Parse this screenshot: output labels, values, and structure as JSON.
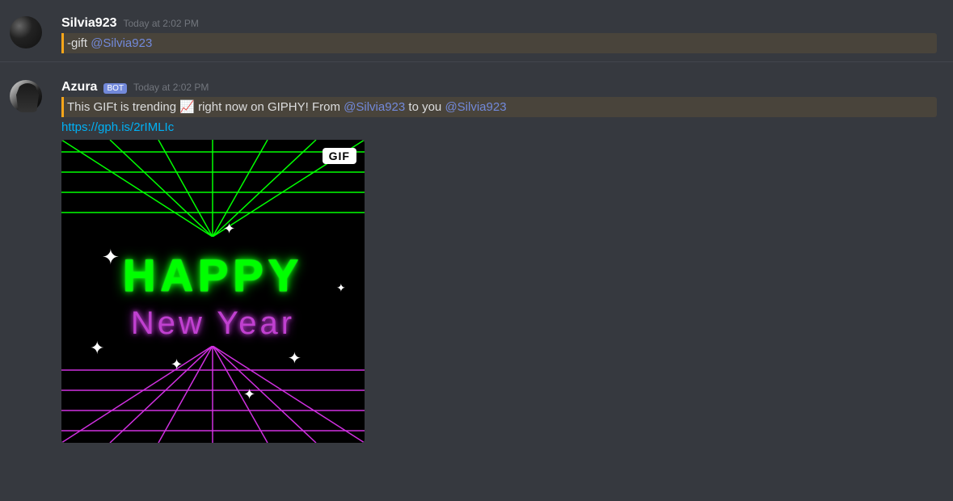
{
  "messages": [
    {
      "author": "Silvia923",
      "is_bot": false,
      "timestamp": "Today at 2:02 PM",
      "content": {
        "prefix": "-gift ",
        "mention": "@Silvia923"
      }
    },
    {
      "author": "Azura",
      "is_bot": true,
      "bot_tag": "BOT",
      "timestamp": "Today at 2:02 PM",
      "content": {
        "part1": "This GIFt is trending ",
        "emoji": "📈",
        "part2": " right now on GIPHY! From ",
        "mention1": "@Silvia923",
        "part3": " to you ",
        "mention2": "@Silvia923"
      },
      "link": "https://gph.is/2rIMLIc",
      "embed": {
        "gif_badge": "GIF",
        "text_line1": "HAPPY",
        "text_line2": "New Year"
      }
    }
  ]
}
